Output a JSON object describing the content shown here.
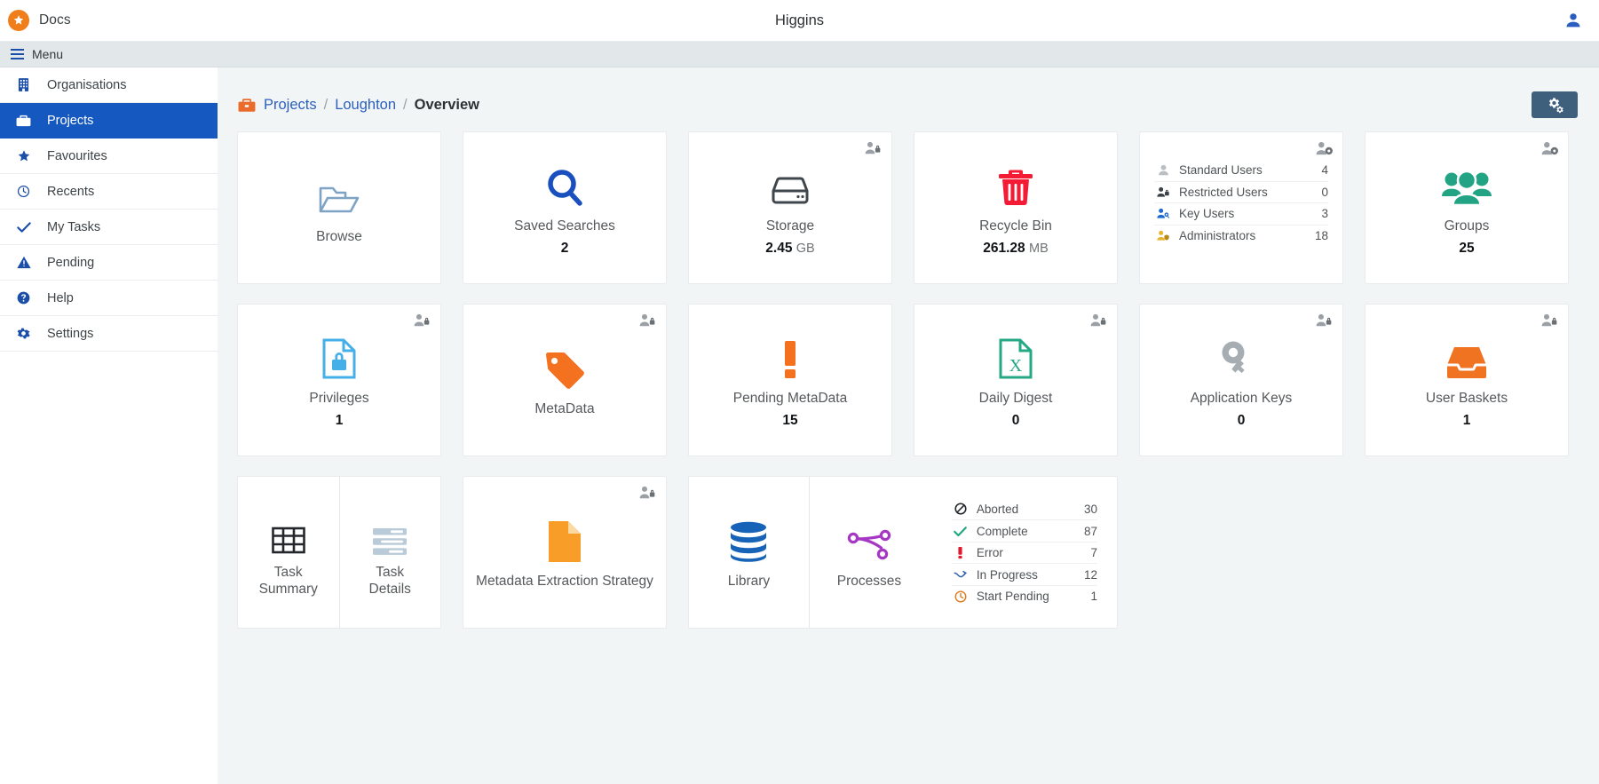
{
  "topbar": {
    "brand": "Docs",
    "brand_icon": "star-burst-icon",
    "title": "Higgins",
    "user_icon": "user-avatar-icon"
  },
  "menubar": {
    "label": "Menu"
  },
  "sidebar": {
    "items": [
      {
        "label": "Organisations",
        "icon": "building-icon",
        "active": false
      },
      {
        "label": "Projects",
        "icon": "briefcase-icon",
        "active": true
      },
      {
        "label": "Favourites",
        "icon": "star-icon",
        "active": false
      },
      {
        "label": "Recents",
        "icon": "clock-icon",
        "active": false
      },
      {
        "label": "My Tasks",
        "icon": "check-icon",
        "active": false
      },
      {
        "label": "Pending",
        "icon": "warning-triangle-icon",
        "active": false
      },
      {
        "label": "Help",
        "icon": "question-circle-icon",
        "active": false
      },
      {
        "label": "Settings",
        "icon": "gear-icon",
        "active": false
      }
    ]
  },
  "breadcrumb": {
    "icon": "briefcase-icon",
    "projects": "Projects",
    "separator": "/",
    "parent": "Loughton",
    "current": "Overview"
  },
  "toolbar": {
    "settings_icon": "cogs-icon"
  },
  "cards": {
    "browse": {
      "label": "Browse",
      "value": "",
      "icon": "open-folder-icon",
      "badge": ""
    },
    "saved": {
      "label": "Saved Searches",
      "value": "2",
      "icon": "magnifier-icon",
      "badge": ""
    },
    "storage": {
      "label": "Storage",
      "value": "2.45",
      "unit": "GB",
      "icon": "hard-drive-icon",
      "badge": "user-lock-icon"
    },
    "recycle": {
      "label": "Recycle Bin",
      "value": "261.28",
      "unit": "MB",
      "icon": "trash-icon",
      "badge": ""
    },
    "users": {
      "badge": "user-gear-icon",
      "rows": [
        {
          "label": "Standard Users",
          "value": "4",
          "icon": "user-icon"
        },
        {
          "label": "Restricted Users",
          "value": "0",
          "icon": "user-lock-icon"
        },
        {
          "label": "Key Users",
          "value": "3",
          "icon": "user-key-icon"
        },
        {
          "label": "Administrators",
          "value": "18",
          "icon": "user-shield-icon"
        }
      ]
    },
    "groups": {
      "label": "Groups",
      "value": "25",
      "icon": "users-group-icon",
      "badge": "user-gear-icon"
    },
    "privileges": {
      "label": "Privileges",
      "value": "1",
      "icon": "document-lock-icon",
      "badge": "user-lock-icon"
    },
    "metadata": {
      "label": "MetaData",
      "value": "",
      "icon": "tag-icon",
      "badge": "user-lock-icon"
    },
    "pending_metadata": {
      "label": "Pending MetaData",
      "value": "15",
      "icon": "exclamation-icon",
      "badge": ""
    },
    "daily_digest": {
      "label": "Daily Digest",
      "value": "0",
      "icon": "excel-file-icon",
      "badge": "user-lock-icon"
    },
    "app_keys": {
      "label": "Application Keys",
      "value": "0",
      "icon": "key-icon",
      "badge": "user-lock-icon"
    },
    "user_baskets": {
      "label": "User Baskets",
      "value": "1",
      "icon": "inbox-icon",
      "badge": "user-lock-icon"
    },
    "task_summary": {
      "label": "Task\nSummary",
      "label_line1": "Task",
      "label_line2": "Summary",
      "icon": "table-grid-icon"
    },
    "task_details": {
      "label_line1": "Task",
      "label_line2": "Details",
      "icon": "list-rows-icon"
    },
    "extraction": {
      "label": "Metadata Extraction Strategy",
      "value": "",
      "icon": "orange-document-icon",
      "badge": "user-lock-icon"
    },
    "library": {
      "label": "Library",
      "icon": "database-icon"
    },
    "processes": {
      "label": "Processes",
      "icon": "workflow-nodes-icon",
      "rows": [
        {
          "label": "Aborted",
          "value": "30",
          "icon": "ban-icon"
        },
        {
          "label": "Complete",
          "value": "87",
          "icon": "check-icon"
        },
        {
          "label": "Error",
          "value": "7",
          "icon": "exclamation-icon"
        },
        {
          "label": "In Progress",
          "value": "12",
          "icon": "progress-arrow-icon"
        },
        {
          "label": "Start Pending",
          "value": "1",
          "icon": "clock-icon"
        }
      ]
    }
  },
  "colors": {
    "accent_blue": "#1558c0",
    "brand_orange": "#ef7e1b",
    "green": "#27a584",
    "red": "#ef1a35",
    "purple": "#a33bbd",
    "slate": "#3e607d"
  }
}
